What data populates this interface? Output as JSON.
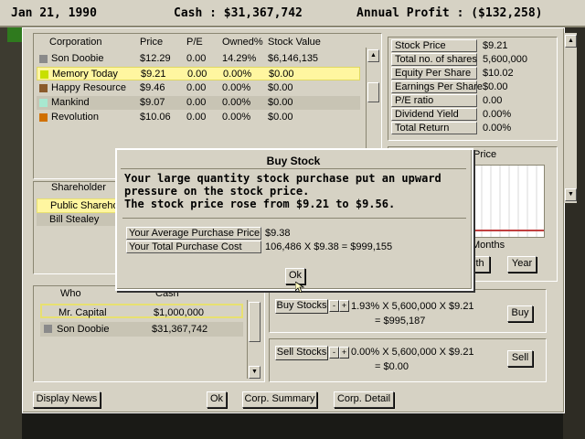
{
  "topbar": {
    "date": "Jan 21, 1990",
    "cash": "Cash : $31,367,742",
    "profit": "Annual Profit : ($132,258)"
  },
  "corp_table": {
    "headers": [
      "Corporation",
      "Price",
      "P/E",
      "Owned%",
      "Stock Value"
    ],
    "rows": [
      {
        "name": "Son Doobie",
        "price": "$12.29",
        "pe": "0.00",
        "owned": "14.29%",
        "value": "$6,146,135",
        "color": "#8a8a8a"
      },
      {
        "name": "Memory Today",
        "price": "$9.21",
        "pe": "0.00",
        "owned": "0.00%",
        "value": "$0.00",
        "color": "#c8e000"
      },
      {
        "name": "Happy Resource",
        "price": "$9.46",
        "pe": "0.00",
        "owned": "0.00%",
        "value": "$0.00",
        "color": "#8a5a2a"
      },
      {
        "name": "Mankind",
        "price": "$9.07",
        "pe": "0.00",
        "owned": "0.00%",
        "value": "$0.00",
        "color": "#a8e8d0"
      },
      {
        "name": "Revolution",
        "price": "$10.06",
        "pe": "0.00",
        "owned": "0.00%",
        "value": "$0.00",
        "color": "#d07000"
      }
    ]
  },
  "stats": [
    {
      "label": "Stock Price",
      "value": "$9.21"
    },
    {
      "label": "Total no. of shares",
      "value": "5,600,000"
    },
    {
      "label": "Equity Per Share",
      "value": "$10.02"
    },
    {
      "label": "Earnings Per Share",
      "value": "$0.00"
    },
    {
      "label": "P/E ratio",
      "value": "0.00"
    },
    {
      "label": "Dividend Yield",
      "value": "0.00%"
    },
    {
      "label": "Total Return",
      "value": "0.00%"
    }
  ],
  "chart": {
    "title_partial": "Price",
    "months_label": "Months",
    "month_button": "nth",
    "year_button": "Year"
  },
  "shareholders": {
    "header": "Shareholder",
    "rows": [
      "Public Shareho",
      "Bill Stealey"
    ]
  },
  "who": {
    "headers": [
      "Who",
      "Cash"
    ],
    "rows": [
      {
        "name": "Mr. Capital",
        "cash": "$1,000,000",
        "color": ""
      },
      {
        "name": "Son Doobie",
        "cash": "$31,367,742",
        "color": "#8a8a8a"
      }
    ]
  },
  "trade": {
    "buy_label": "Buy Stocks",
    "buy_formula": "1.93% X 5,600,000 X $9.21",
    "buy_result": "= $995,187",
    "buy_button": "Buy",
    "sell_label": "Sell Stocks",
    "sell_formula": "0.00% X 5,600,000 X $9.21",
    "sell_result": "= $0.00",
    "sell_button": "Sell",
    "minus": "-",
    "plus": "+"
  },
  "bottom_buttons": {
    "display_news": "Display News",
    "ok": "Ok",
    "corp_summary": "Corp. Summary",
    "corp_detail": "Corp. Detail"
  },
  "dialog": {
    "title": "Buy Stock",
    "line1": "Your large quantity stock purchase put an upward",
    "line2": "pressure on the stock price.",
    "line3": "The stock price rose from $9.21 to $9.56.",
    "avg_label": "Your Average Purchase Price",
    "avg_value": "$9.38",
    "total_label": "Your Total Purchase Cost",
    "total_value": "106,486 X $9.38 = $999,155",
    "ok": "Ok"
  }
}
